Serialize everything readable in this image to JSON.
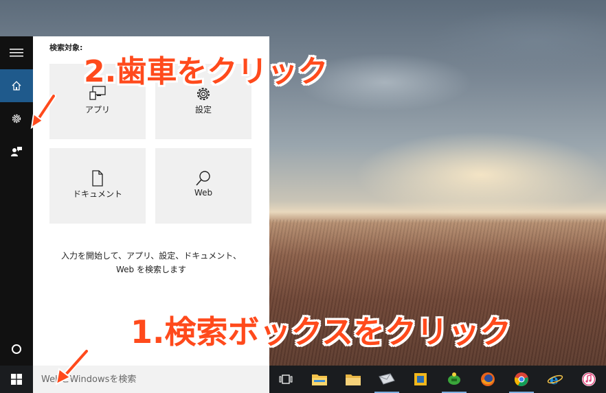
{
  "search_panel": {
    "heading": "検索対象:",
    "tiles": [
      {
        "label": "アプリ",
        "icon": "apps-icon"
      },
      {
        "label": "設定",
        "icon": "settings-gear-icon"
      },
      {
        "label": "ドキュメント",
        "icon": "document-icon"
      },
      {
        "label": "Web",
        "icon": "web-search-icon"
      }
    ],
    "hint_line1": "入力を開始して、アプリ、設定、ドキュメント、",
    "hint_line2": "Web を検索します"
  },
  "rail": {
    "items": [
      {
        "icon": "hamburger-menu-icon"
      },
      {
        "icon": "home-icon",
        "active": true
      },
      {
        "icon": "gear-icon"
      },
      {
        "icon": "feedback-icon"
      },
      {
        "icon": "cortana-circle-icon"
      }
    ]
  },
  "searchbox": {
    "placeholder": "WebとWindowsを検索"
  },
  "taskbar": {
    "items": [
      {
        "icon": "windows-start-icon"
      },
      {
        "icon": "task-view-icon"
      },
      {
        "icon": "file-explorer-icon"
      },
      {
        "icon": "folder-icon"
      },
      {
        "icon": "mail-app-icon"
      },
      {
        "icon": "yellow-square-app-icon"
      },
      {
        "icon": "tortoise-app-icon"
      },
      {
        "icon": "firefox-icon"
      },
      {
        "icon": "chrome-icon"
      },
      {
        "icon": "internet-explorer-icon"
      },
      {
        "icon": "itunes-icon"
      }
    ]
  },
  "annotations": {
    "step2": "2.歯車をクリック",
    "step1": "1.検索ボックスをクリック"
  },
  "colors": {
    "rail_bg": "#111111",
    "rail_active": "#1f5a8c",
    "annotation_red": "#ff4a1c",
    "taskbar_bg": "#1a1c1f"
  }
}
